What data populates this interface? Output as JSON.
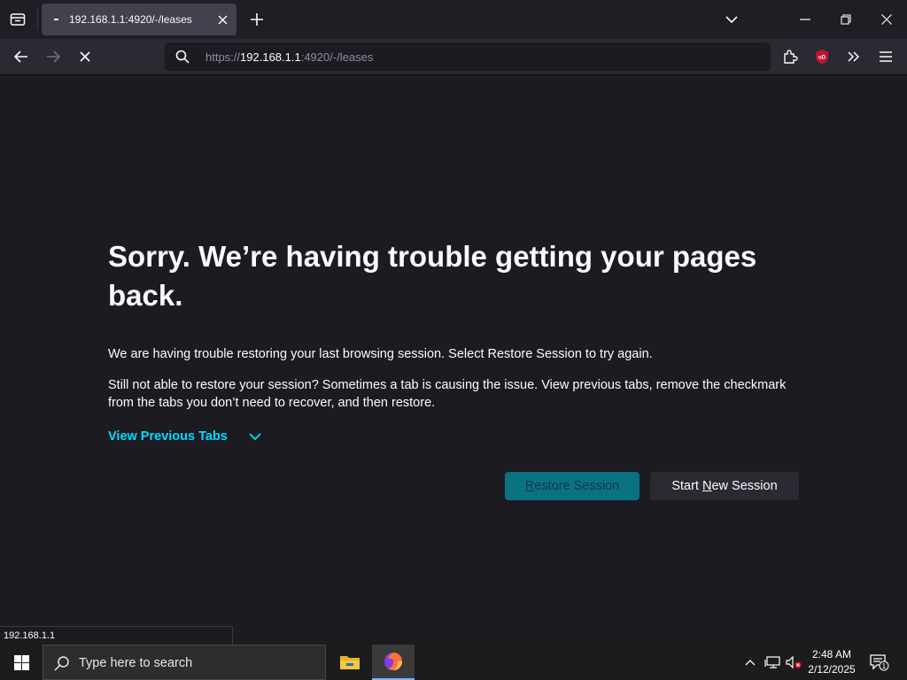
{
  "browser": {
    "tab": {
      "title": "192.168.1.1:4920/-/leases"
    },
    "url": {
      "scheme": "https://",
      "host": "192.168.1.1",
      "path": ":4920/-/leases"
    },
    "toolbar": {
      "extension_badge": "uD"
    }
  },
  "page": {
    "title": "Sorry. We’re having trouble getting your pages back.",
    "paragraph1": "We are having trouble restoring your last browsing session. Select Restore Session to try again.",
    "paragraph2": "Still not able to restore your session? Sometimes a tab is causing the issue. View previous tabs, remove the checkmark from the tabs you don’t need to recover, and then restore.",
    "view_previous_tabs": "View Previous Tabs",
    "restore_button": {
      "access_key": "R",
      "rest": "estore Session"
    },
    "new_session_button": {
      "pre": "Start ",
      "access_key": "N",
      "rest": "ew Session"
    }
  },
  "status_bar": {
    "text": "192.168.1.1"
  },
  "taskbar": {
    "search_placeholder": "Type here to search",
    "clock": {
      "time": "2:48 AM",
      "date": "2/12/2025"
    },
    "notification_count": "1"
  },
  "colors": {
    "accent": "#00ddff",
    "restore_bg": "#0b7282",
    "page_bg": "#1c1b22"
  }
}
